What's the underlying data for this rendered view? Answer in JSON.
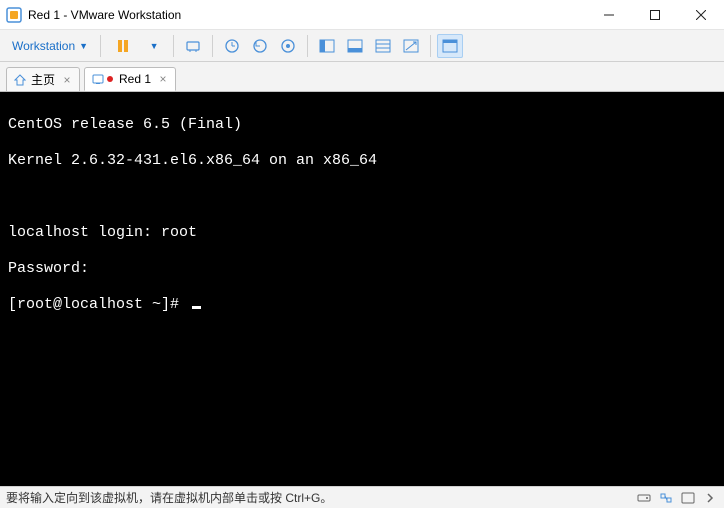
{
  "window": {
    "title": "Red 1 - VMware Workstation"
  },
  "menu": {
    "label": "Workstation"
  },
  "tabs": {
    "home": "主页",
    "red1": "Red 1"
  },
  "terminal": {
    "line1": "CentOS release 6.5 (Final)",
    "line2": "Kernel 2.6.32-431.el6.x86_64 on an x86_64",
    "line3": "localhost login: root",
    "line4": "Password:",
    "line5": "[root@localhost ~]# "
  },
  "status": {
    "msg": "要将输入定向到该虚拟机，请在虚拟机内部单击或按 Ctrl+G。"
  },
  "colors": {
    "accent": "#1a6fc8",
    "pause": "#f5a623"
  }
}
